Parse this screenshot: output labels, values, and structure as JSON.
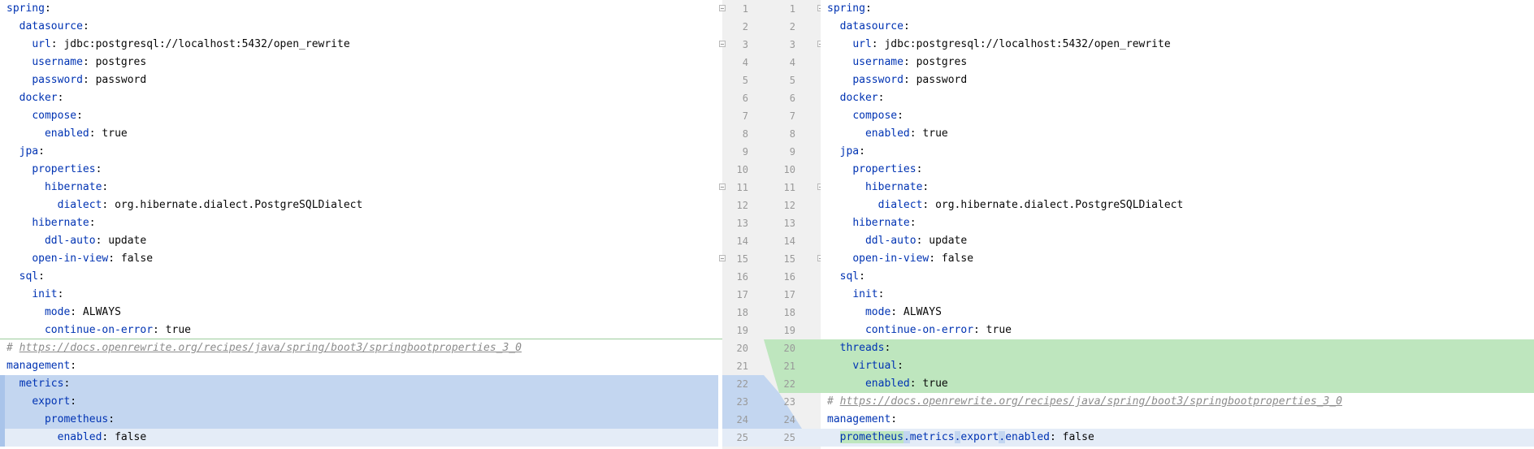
{
  "left": {
    "lines": [
      [
        {
          "t": "spring",
          "k": 1
        },
        {
          "t": ":"
        }
      ],
      [
        {
          "t": "  "
        },
        {
          "t": "datasource",
          "k": 1
        },
        {
          "t": ":"
        }
      ],
      [
        {
          "t": "    "
        },
        {
          "t": "url",
          "k": 1
        },
        {
          "t": ": jdbc:postgresql://localhost:5432/open_rewrite"
        }
      ],
      [
        {
          "t": "    "
        },
        {
          "t": "username",
          "k": 1
        },
        {
          "t": ": postgres"
        }
      ],
      [
        {
          "t": "    "
        },
        {
          "t": "password",
          "k": 1
        },
        {
          "t": ": password"
        }
      ],
      [
        {
          "t": "  "
        },
        {
          "t": "docker",
          "k": 1
        },
        {
          "t": ":"
        }
      ],
      [
        {
          "t": "    "
        },
        {
          "t": "compose",
          "k": 1
        },
        {
          "t": ":"
        }
      ],
      [
        {
          "t": "      "
        },
        {
          "t": "enabled",
          "k": 1
        },
        {
          "t": ": true"
        }
      ],
      [
        {
          "t": "  "
        },
        {
          "t": "jpa",
          "k": 1
        },
        {
          "t": ":"
        }
      ],
      [
        {
          "t": "    "
        },
        {
          "t": "properties",
          "k": 1
        },
        {
          "t": ":"
        }
      ],
      [
        {
          "t": "      "
        },
        {
          "t": "hibernate",
          "k": 1
        },
        {
          "t": ":"
        }
      ],
      [
        {
          "t": "        "
        },
        {
          "t": "dialect",
          "k": 1
        },
        {
          "t": ": org.hibernate.dialect.PostgreSQLDialect"
        }
      ],
      [
        {
          "t": "    "
        },
        {
          "t": "hibernate",
          "k": 1
        },
        {
          "t": ":"
        }
      ],
      [
        {
          "t": "      "
        },
        {
          "t": "ddl-auto",
          "k": 1
        },
        {
          "t": ": update"
        }
      ],
      [
        {
          "t": "    "
        },
        {
          "t": "open-in-view",
          "k": 1
        },
        {
          "t": ": false"
        }
      ],
      [
        {
          "t": "  "
        },
        {
          "t": "sql",
          "k": 1
        },
        {
          "t": ":"
        }
      ],
      [
        {
          "t": "    "
        },
        {
          "t": "init",
          "k": 1
        },
        {
          "t": ":"
        }
      ],
      [
        {
          "t": "      "
        },
        {
          "t": "mode",
          "k": 1
        },
        {
          "t": ": ALWAYS"
        }
      ],
      [
        {
          "t": "      "
        },
        {
          "t": "continue-on-error",
          "k": 1
        },
        {
          "t": ": true"
        }
      ],
      [
        {
          "t": "# ",
          "c": 1
        },
        {
          "t": "https://docs.openrewrite.org/recipes/java/spring/boot3/springbootproperties_3_0",
          "c": 1,
          "u": 1
        }
      ],
      [
        {
          "t": "management",
          "k": 1
        },
        {
          "t": ":"
        }
      ],
      [
        {
          "t": "  "
        },
        {
          "t": "metrics",
          "k": 1
        },
        {
          "t": ":"
        }
      ],
      [
        {
          "t": "    "
        },
        {
          "t": "export",
          "k": 1
        },
        {
          "t": ":"
        }
      ],
      [
        {
          "t": "      "
        },
        {
          "t": "prometheus",
          "k": 1
        },
        {
          "t": ":"
        }
      ],
      [
        {
          "t": "        "
        },
        {
          "t": "enabled",
          "k": 1
        },
        {
          "t": ": false"
        }
      ]
    ]
  },
  "right": {
    "lines": [
      [
        {
          "t": "spring",
          "k": 1
        },
        {
          "t": ":"
        }
      ],
      [
        {
          "t": "  "
        },
        {
          "t": "datasource",
          "k": 1
        },
        {
          "t": ":"
        }
      ],
      [
        {
          "t": "    "
        },
        {
          "t": "url",
          "k": 1
        },
        {
          "t": ": jdbc:postgresql://localhost:5432/open_rewrite"
        }
      ],
      [
        {
          "t": "    "
        },
        {
          "t": "username",
          "k": 1
        },
        {
          "t": ": postgres"
        }
      ],
      [
        {
          "t": "    "
        },
        {
          "t": "password",
          "k": 1
        },
        {
          "t": ": password"
        }
      ],
      [
        {
          "t": "  "
        },
        {
          "t": "docker",
          "k": 1
        },
        {
          "t": ":"
        }
      ],
      [
        {
          "t": "    "
        },
        {
          "t": "compose",
          "k": 1
        },
        {
          "t": ":"
        }
      ],
      [
        {
          "t": "      "
        },
        {
          "t": "enabled",
          "k": 1
        },
        {
          "t": ": true"
        }
      ],
      [
        {
          "t": "  "
        },
        {
          "t": "jpa",
          "k": 1
        },
        {
          "t": ":"
        }
      ],
      [
        {
          "t": "    "
        },
        {
          "t": "properties",
          "k": 1
        },
        {
          "t": ":"
        }
      ],
      [
        {
          "t": "      "
        },
        {
          "t": "hibernate",
          "k": 1
        },
        {
          "t": ":"
        }
      ],
      [
        {
          "t": "        "
        },
        {
          "t": "dialect",
          "k": 1
        },
        {
          "t": ": org.hibernate.dialect.PostgreSQLDialect"
        }
      ],
      [
        {
          "t": "    "
        },
        {
          "t": "hibernate",
          "k": 1
        },
        {
          "t": ":"
        }
      ],
      [
        {
          "t": "      "
        },
        {
          "t": "ddl-auto",
          "k": 1
        },
        {
          "t": ": update"
        }
      ],
      [
        {
          "t": "    "
        },
        {
          "t": "open-in-view",
          "k": 1
        },
        {
          "t": ": false"
        }
      ],
      [
        {
          "t": "  "
        },
        {
          "t": "sql",
          "k": 1
        },
        {
          "t": ":"
        }
      ],
      [
        {
          "t": "    "
        },
        {
          "t": "init",
          "k": 1
        },
        {
          "t": ":"
        }
      ],
      [
        {
          "t": "      "
        },
        {
          "t": "mode",
          "k": 1
        },
        {
          "t": ": ALWAYS"
        }
      ],
      [
        {
          "t": "      "
        },
        {
          "t": "continue-on-error",
          "k": 1
        },
        {
          "t": ": true"
        }
      ],
      [
        {
          "t": "  "
        },
        {
          "t": "threads",
          "k": 1
        },
        {
          "t": ":"
        }
      ],
      [
        {
          "t": "    "
        },
        {
          "t": "virtual",
          "k": 1
        },
        {
          "t": ":"
        }
      ],
      [
        {
          "t": "      "
        },
        {
          "t": "enabled",
          "k": 1
        },
        {
          "t": ": true"
        }
      ],
      [
        {
          "t": "# ",
          "c": 1
        },
        {
          "t": "https://docs.openrewrite.org/recipes/java/spring/boot3/springbootproperties_3_0",
          "c": 1,
          "u": 1
        }
      ],
      [
        {
          "t": "management",
          "k": 1
        },
        {
          "t": ":"
        }
      ],
      [
        {
          "t": "  "
        },
        {
          "t": "prometheus",
          "k": 1,
          "hl": "add"
        },
        {
          "t": ".",
          "k": 1,
          "hl": "mod"
        },
        {
          "t": "metrics",
          "k": 1
        },
        {
          "t": ".",
          "k": 1,
          "hl": "mod"
        },
        {
          "t": "export",
          "k": 1
        },
        {
          "t": ".",
          "k": 1,
          "hl": "mod"
        },
        {
          "t": "enabled",
          "k": 1
        },
        {
          "t": ": false"
        }
      ]
    ]
  },
  "gutter": {
    "left_numbers": [
      "1",
      "2",
      "3",
      "4",
      "5",
      "6",
      "7",
      "8",
      "9",
      "10",
      "11",
      "12",
      "13",
      "14",
      "15",
      "16",
      "17",
      "18",
      "19",
      "20",
      "21",
      "22",
      "23",
      "24",
      "25"
    ],
    "right_numbers": [
      "1",
      "2",
      "3",
      "4",
      "5",
      "6",
      "7",
      "8",
      "9",
      "10",
      "11",
      "12",
      "13",
      "14",
      "15",
      "16",
      "17",
      "18",
      "19",
      "20",
      "21",
      "22",
      "23",
      "24",
      "25"
    ]
  },
  "colors": {
    "added": "#bee6be",
    "deleted": "#c3d6f0",
    "modified_light": "#e4ecf7",
    "keyword": "#0033b3",
    "comment": "#8c8c8c",
    "gutter_bg": "#f0f0f0"
  }
}
